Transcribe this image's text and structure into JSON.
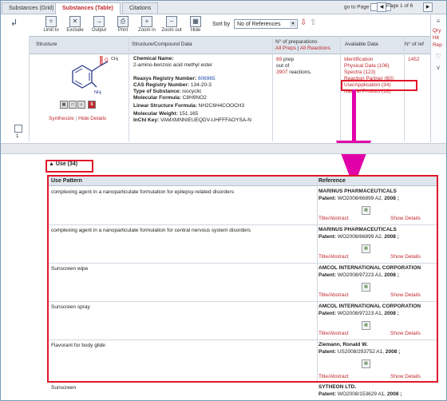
{
  "tabs": [
    {
      "label": "Substances (Grid)"
    },
    {
      "label": "Substances (Table)"
    },
    {
      "label": "Citations"
    }
  ],
  "pager": {
    "goto_label": "go to Page",
    "page_info": "Page 1 of 6"
  },
  "toolbar": {
    "limit": "Limit to",
    "exclude": "Exclude",
    "output": "Output",
    "print": "Print",
    "zoom_in": "Zoom in",
    "zoom_out": "Zoom out",
    "hide": "Hide",
    "sort_label": "Sort by",
    "sort_value": "No of References"
  },
  "sidebar": {
    "items": [
      "Qry",
      "Hit",
      "Rep"
    ]
  },
  "table_header": {
    "structure": "Structure",
    "compound": "Structure/Compound Data",
    "preps_title": "N° of preparations",
    "all_preps": "All Preps",
    "all_reactions": "All Reactions",
    "available": "Available Data",
    "refs": "N° of ref"
  },
  "row": {
    "number": "1",
    "synthesize": "Synthesize",
    "hide_details": "Hide Details",
    "structure_labels": {
      "methyl": "CH",
      "methyl_sub": "3",
      "amine": "NH",
      "amine_sub": "2"
    },
    "chemical_name_label": "Chemical Name:",
    "chemical_name": "2-amino-benzoic acid methyl ester",
    "reaxys_label": "Reaxys Registry Number:",
    "reaxys": "606965",
    "cas_label": "CAS Registry Number:",
    "cas": "134-20-3",
    "type_label": "Type of Substance:",
    "type": "isocyclic",
    "formula_label": "Molecular Formula:",
    "formula": "C8H9NO2",
    "linear_label": "Linear Structure Formula:",
    "linear": "NH2C6H4COOCH3",
    "weight_label": "Molecular Weight:",
    "weight": "151.165",
    "inchi_label": "InChI Key:",
    "inchi": "VAMXMNNIEUEQDV-UHFFFAOYSA-N",
    "preps_count": "69",
    "preps_text": "prep",
    "out_of": "out of",
    "reactions_count": "3907",
    "reactions_text": "reactions.",
    "available": [
      "Identification",
      "Physical Data (106)",
      "Spectra (123)",
      "Reaction Partner (60)",
      "Use/Application (34)",
      "Natural Product (18)"
    ],
    "ref_count": "1452"
  },
  "use": {
    "header": "Use (34)",
    "col_pattern": "Use Pattern",
    "col_reference": "Reference",
    "title_abstract": "Title/Abstract",
    "show_details": "Show Details",
    "rows": [
      {
        "pattern": "complexing agent in a nanoparticulate formulation for epilepsy-related disorders",
        "company": "MARINUS PHARMACEUTICALS",
        "patent": "WO2008/66899 A2,",
        "year": "2008"
      },
      {
        "pattern": "complexing agent in a nanoparticulate formulation for central nervous system disorders",
        "company": "MARINUS PHARMACEUTICALS",
        "patent": "WO2008/66899 A2,",
        "year": "2008"
      },
      {
        "pattern": "Sunscreen wipe",
        "company": "AMCOL INTERNATIONAL CORPORATION",
        "patent": "WO2008/97223 A1,",
        "year": "2008"
      },
      {
        "pattern": "Sunscreen spray",
        "company": "AMCOL INTERNATIONAL CORPORATION",
        "patent": "WO2008/97223 A1,",
        "year": "2008"
      },
      {
        "pattern": "Flavorant for body glide",
        "company": "Ziemann, Ronald W.",
        "patent": "US2008/293752 A1,",
        "year": "2008"
      }
    ],
    "last": {
      "pattern": "Sunscreen",
      "company": "SYTHEON LTD.",
      "patent": "WO2008/153629 A1,",
      "year": "2008"
    },
    "patent_label": "Patent:"
  }
}
